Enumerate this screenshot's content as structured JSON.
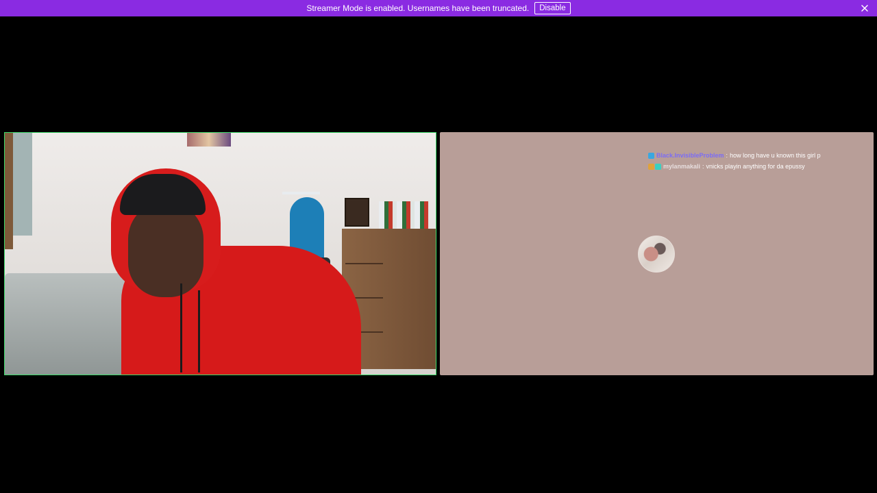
{
  "banner": {
    "message": "Streamer Mode is enabled. Usernames have been truncated.",
    "disable_label": "Disable",
    "close_icon": "close-icon",
    "color": "#8a2be2"
  },
  "tiles": {
    "left_border_color": "#3ddc6a",
    "right_bg_color": "#b89e98"
  },
  "chat": {
    "messages": [
      {
        "badges": [
          {
            "icon": "badge-icon",
            "color": "#3aa7e0"
          }
        ],
        "username": "Black.InvisibleProblem",
        "user_color": "#7b6cf6",
        "text": "how long have u known this girl p"
      },
      {
        "badges": [
          {
            "icon": "badge-icon",
            "color": "#e0a23a"
          },
          {
            "icon": "badge-icon",
            "color": "#3ad0c0"
          }
        ],
        "username": "mylanmakali",
        "user_color": "#e7dede",
        "text": "vnicks playin anything for da epussy"
      }
    ]
  }
}
